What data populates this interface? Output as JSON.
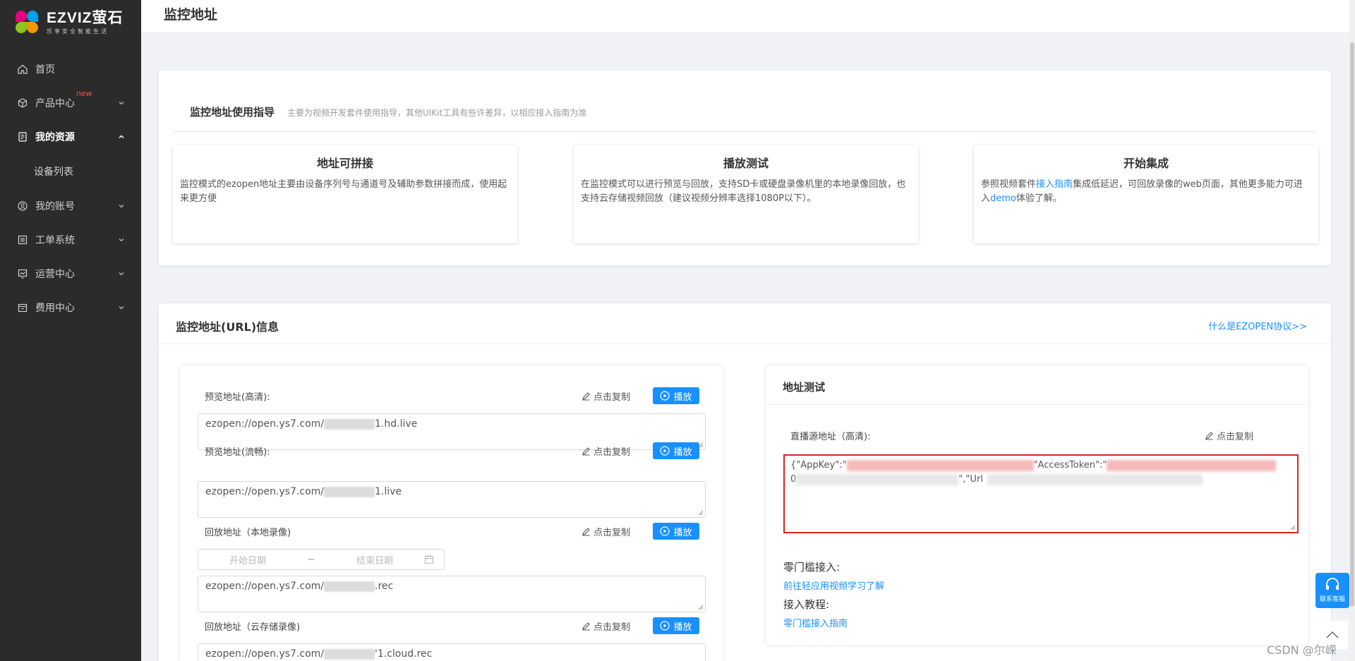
{
  "brand": {
    "name": "EZVIZ萤石",
    "slogan": "乐享安全智能生活"
  },
  "sidebar": {
    "items": [
      {
        "label": "首页",
        "icon": "home-icon"
      },
      {
        "label": "产品中心",
        "icon": "box-icon",
        "badge": "new"
      },
      {
        "label": "我的资源",
        "icon": "document-icon",
        "expanded": true,
        "sub": "设备列表"
      },
      {
        "label": "我的账号",
        "icon": "user-icon"
      },
      {
        "label": "工单系统",
        "icon": "list-icon"
      },
      {
        "label": "运营中心",
        "icon": "chart-icon"
      },
      {
        "label": "费用中心",
        "icon": "wallet-icon"
      }
    ]
  },
  "header": {
    "title": "监控地址"
  },
  "guide": {
    "title": "监控地址使用指导",
    "desc": "主要为视频开发套件使用指导，其他UIKit工具有些许差异，以相应接入指南为准",
    "features": [
      {
        "title": "地址可拼接",
        "body": "监控模式的ezopen地址主要由设备序列号与通道号及辅助参数拼接而成，使用起来更方便"
      },
      {
        "title": "播放测试",
        "body": "在监控模式可以进行预览与回放，支持SD卡或硬盘录像机里的本地录像回放，也支持云存储视频回放（建议视频分辨率选择1080P以下）。"
      },
      {
        "title": "开始集成",
        "body_pre": "参照视频套件",
        "link1": "接入指南",
        "body_mid": "集成低延迟，可回放录像的web页面，其他更多能力可进入",
        "link2": "demo",
        "body_post": "体验了解。"
      }
    ]
  },
  "url_info": {
    "title": "监控地址(URL)信息",
    "help_link": "什么是EZOPEN协议>>",
    "copy_label": "点击复制",
    "play_label": "播放",
    "fields": [
      {
        "label": "预览地址(高清):",
        "prefix": "ezopen://open.ys7.com/",
        "suffix": "1.hd.live"
      },
      {
        "label": "预览地址(流畅):",
        "prefix": "ezopen://open.ys7.com/",
        "suffix": "1.live"
      },
      {
        "label": "回放地址（本地录像)",
        "prefix": "ezopen://open.ys7.com/",
        "suffix": ".rec"
      },
      {
        "label": "回放地址（云存储录像)",
        "prefix": "ezopen://open.ys7.com/",
        "suffix": "'1.cloud.rec"
      }
    ],
    "date_start": "开始日期",
    "date_sep": "~",
    "date_end": "结束日期"
  },
  "test": {
    "title": "地址测试",
    "live_label": "直播源地址（高清):",
    "copy_label": "点击复制",
    "token_line1_a": "{\"AppKey\":\"",
    "token_line1_b": "\"AccessToken\":\"",
    "token_line2_a": "0",
    "token_line2_b": "\",\"Url",
    "zero_label": "零门槛接入:",
    "zero_link": "前往轻应用视频学习了解",
    "tutorial_label": "接入教程:",
    "tutorial_link": "零门槛接入指南"
  },
  "service": {
    "label": "联系客服"
  },
  "watermark": "CSDN @尔嵘"
}
